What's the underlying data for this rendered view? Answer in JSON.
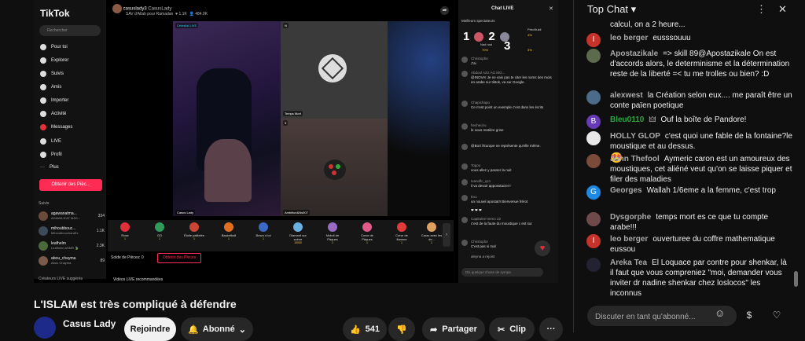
{
  "tiktok": {
    "logo": "TikTok",
    "search_placeholder": "Rechercher",
    "nav": [
      "Pour toi",
      "Explorer",
      "Suivis",
      "Amis",
      "Importer",
      "Activité",
      "Messages",
      "LIVE",
      "Profil",
      "Plus"
    ],
    "obtenir_btn": "Obtenir des Pièc...",
    "suivis_title": "Suivis",
    "suivis": [
      {
        "name": "agawanatma...",
        "sub": "AGAWA N'AT MAS...",
        "count": "334"
      },
      {
        "name": "mihoubbouc...",
        "sub": "MihoubboucharaEx",
        "count": "1.1K"
      },
      {
        "name": "leafhelm",
        "sub": "Leafhelm ASMR 🍃",
        "count": "2.3K"
      },
      {
        "name": "abou_chayma",
        "sub": "Abou Chayma",
        "count": "89"
      }
    ],
    "createurs": "Créateurs LIVE suggérés",
    "stream": {
      "host": "casuslady3",
      "host_label": "CasusLady",
      "likes": "1.1K",
      "viewers": "484.0K",
      "subtitle": "SAV d'Allah pour Ramadan"
    },
    "panels": {
      "main_tag": "Celestial LIVE",
      "main_name": "Casus Lady",
      "tr_tag": "N",
      "tr_name": "Temps Mort",
      "br_tag": "3",
      "br_name": "Ambition&Ns007"
    },
    "gifts": [
      {
        "name": "Rose",
        "coin": "1"
      },
      {
        "name": "GG",
        "coin": "1"
      },
      {
        "name": "Étoile pailletée",
        "coin": "1"
      },
      {
        "name": "Basketball",
        "coin": "1"
      },
      {
        "name": "Bravo à toi",
        "coin": "1"
      },
      {
        "name": "Diamant sur scène",
        "coin": "10000"
      },
      {
        "name": "Motoli de Pâques",
        "coin": "1"
      },
      {
        "name": "Cœur de Pâques",
        "coin": "1"
      },
      {
        "name": "Cœur de flamme",
        "coin": "1"
      },
      {
        "name": "Carac avec les de...",
        "coin": "1"
      }
    ],
    "solde": "Solde de Pièces: 0",
    "obtenir_btn2": "Obtenir des Pièces",
    "recommended": "Vidéos LIVE recommandées",
    "chat_title": "Chat LIVE",
    "meilleurs": "Meilleurs spectateurs",
    "top": [
      {
        "rank": "1",
        "name": "Nad nad",
        "coin": "70%"
      },
      {
        "rank": "2",
        "name": "Prbcl9ukil",
        "coin": "4%"
      },
      {
        "rank": "3",
        "name": "",
        "coin": "3%"
      }
    ],
    "chat": [
      {
        "user": "Christophe",
        "text": "J'ai"
      },
      {
        "user": "Abdoul Aziz AG MO...",
        "text": "@INOVA! Je ne vais pas te citer les noms des mois en arabe sur tiktok, va sur Google."
      },
      {
        "user": "Chapichapo",
        "text": "Ce n'est point un exemple c'est dans les écrits"
      },
      {
        "user": "hecheciro",
        "text": "le sous matière grise"
      },
      {
        "user": "",
        "text": "@Bort l'Europe ne représente qu'elle même."
      },
      {
        "user": "Togoo",
        "text": "vous allez y passer la nuit"
      },
      {
        "user": "Ivanoflc_qc1",
        "text": "il va devoir apposstacier?"
      },
      {
        "user": "Evo",
        "text": "un nouvel apostat!! Bienvenue frérot"
      },
      {
        "user": "",
        "text": "❤ ❤ ❤"
      },
      {
        "user": "Capitaine-nemo 22",
        "text": "c'est de la faute du moustique c est sur"
      },
      {
        "user": "Christophe",
        "text": "C'est pas si mal"
      },
      {
        "user": "",
        "text": "aleyna a rejoint"
      }
    ],
    "chat_input_placeholder": "Dis quelque chose de sympa"
  },
  "video": {
    "title": "L'ISLAM est très compliqué à défendre",
    "channel": "Casus Lady",
    "join_label": "Rejoindre",
    "subscribed_label": "Abonné",
    "likes": "541",
    "share_label": "Partager",
    "clip_label": "Clip",
    "more": "···"
  },
  "ytchat": {
    "title": "Top Chat",
    "title_chevron": "▾",
    "partial_top": "calcul, on a 2 heure...",
    "messages": [
      {
        "author": "leo berger",
        "text": "eusssouuu",
        "avatar_letter": "I",
        "avatar_color": "#c5332b"
      },
      {
        "author": "Apostazikale",
        "text": "=> skill 89@Apostazikale On est d'accords alors, le determinisme et la détermination reste de la liberté =< tu me trolles ou bien? :D",
        "avatar_letter": "",
        "avatar_color": "#5c6a4e"
      },
      {
        "author": "alexwest",
        "text": "la Création selon eux.... me paraît être un conte païen poetique",
        "avatar_letter": "",
        "avatar_color": "#4a6c8a"
      },
      {
        "author": "Bleu0110",
        "text": "Ouf la boîte de Pandore!",
        "avatar_letter": "B",
        "avatar_color": "#673ab7",
        "green": true,
        "badge": "🜲"
      },
      {
        "author": "HOLLY GLOP",
        "text": "c'est quoi une fable de la fontaine?le moustique et au dessus.",
        "avatar_letter": "",
        "avatar_color": "#e8e8e8",
        "emoji": "😍"
      },
      {
        "author": "John Thefool",
        "text": "Aymeric caron est un amoureux des moustiques, cet aliéné veut qu'on se laisse piquer et filer des maladies",
        "avatar_letter": "",
        "avatar_color": "#7a4a3a"
      },
      {
        "author": "Georges",
        "text": "Wallah 1/6eme a la femme, c'est trop",
        "avatar_letter": "G",
        "avatar_color": "#1e88e5"
      },
      {
        "author": "Dysgorphe",
        "text": "temps mort es ce que tu compte arabe!!!",
        "avatar_letter": "",
        "avatar_color": "#6e4a4a"
      },
      {
        "author": "leo berger",
        "text": "ouverturee du coffre mathematique eussou",
        "avatar_letter": "I",
        "avatar_color": "#c5332b"
      },
      {
        "author": "Areka Tea",
        "text": "El Loquace par contre pour shenkar, là il faut que vous compreniez \"moi, demander vous inviter dr nadine shenkar chez loslocos\" les inconnus",
        "avatar_letter": "",
        "avatar_color": "#223"
      }
    ],
    "input_placeholder": "Discuter en tant qu'abonné...",
    "colors": {
      "green": "#2ba640",
      "accent_red": "#fe2c55"
    }
  }
}
